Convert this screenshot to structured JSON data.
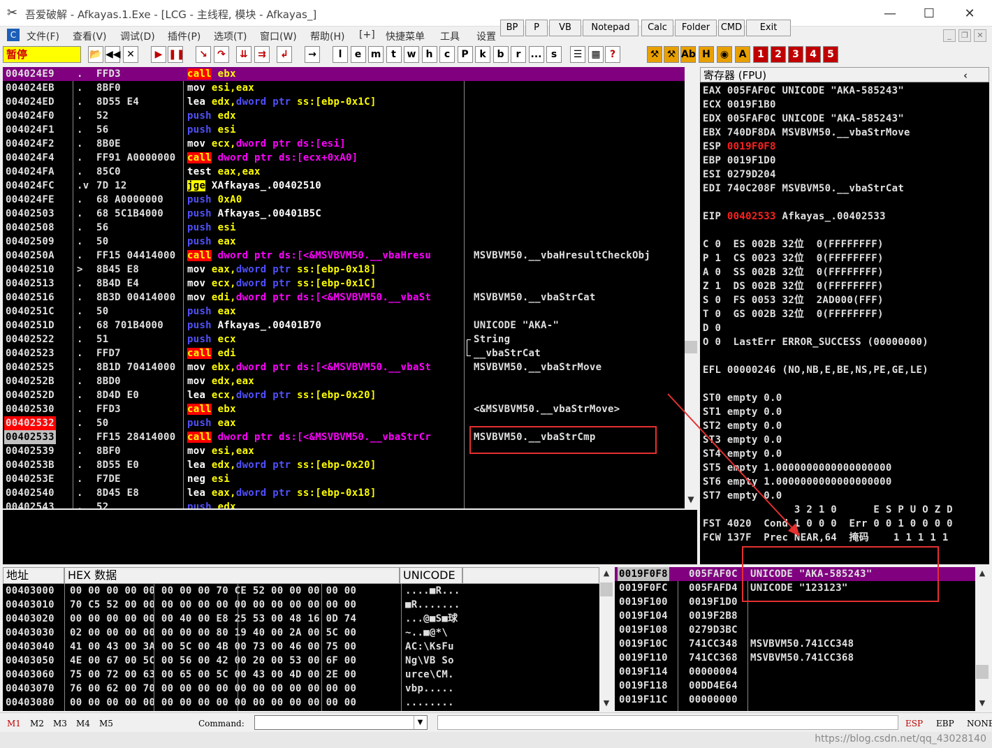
{
  "window": {
    "title": "吾爱破解 - Afkayas.1.Exe - [LCG - 主线程, 模块 - Afkayas_]",
    "minimize": "—",
    "maximize": "☐",
    "close": "✕"
  },
  "menu": [
    "文件(F)",
    "查看(V)",
    "调试(D)",
    "插件(P)",
    "选项(T)",
    "窗口(W)",
    "帮助(H)",
    "[+]",
    "快捷菜单",
    "工具",
    "设置"
  ],
  "quick_buttons": [
    "BP",
    "P",
    "VB",
    "Notepad",
    "Calc",
    "Folder",
    "CMD",
    "Exit"
  ],
  "toolbar": {
    "status": "暂停",
    "letters": [
      "l",
      "e",
      "m",
      "t",
      "w",
      "h",
      "c",
      "P",
      "k",
      "b",
      "r",
      "...",
      "s"
    ],
    "numbers": [
      "1",
      "2",
      "3",
      "4",
      "5"
    ]
  },
  "disasm": [
    {
      "addr": "004024E9",
      "m": ".",
      "hex": "FFD3",
      "ins": [
        [
          "call",
          "call"
        ],
        [
          " ",
          ""
        ],
        [
          "ebx",
          "dis-y"
        ]
      ],
      "cmt": "",
      "row": "purple"
    },
    {
      "addr": "004024EB",
      "m": ".",
      "hex": "8BF0",
      "ins": [
        [
          "mov ",
          "dis-w"
        ],
        [
          "esi,eax",
          "dis-y"
        ]
      ],
      "cmt": ""
    },
    {
      "addr": "004024ED",
      "m": ".",
      "hex": "8D55 E4",
      "ins": [
        [
          "lea ",
          "dis-w"
        ],
        [
          "edx,",
          "dis-y"
        ],
        [
          "dword ptr ",
          "dis-b"
        ],
        [
          "ss:[ebp-0x1C]",
          "dis-y"
        ]
      ],
      "cmt": ""
    },
    {
      "addr": "004024F0",
      "m": ".",
      "hex": "52",
      "ins": [
        [
          "push ",
          "dis-b"
        ],
        [
          "edx",
          "dis-y"
        ]
      ],
      "cmt": ""
    },
    {
      "addr": "004024F1",
      "m": ".",
      "hex": "56",
      "ins": [
        [
          "push ",
          "dis-b"
        ],
        [
          "esi",
          "dis-y"
        ]
      ],
      "cmt": ""
    },
    {
      "addr": "004024F2",
      "m": ".",
      "hex": "8B0E",
      "ins": [
        [
          "mov ",
          "dis-w"
        ],
        [
          "ecx,",
          "dis-y"
        ],
        [
          "dword ptr ",
          "dis-m"
        ],
        [
          "ds:[esi]",
          "dis-m"
        ]
      ],
      "cmt": ""
    },
    {
      "addr": "004024F4",
      "m": ".",
      "hex": "FF91 A0000000",
      "ins": [
        [
          "call",
          "call"
        ],
        [
          " dword ptr ds:[ecx+0xA0]",
          "dis-m"
        ]
      ],
      "cmt": ""
    },
    {
      "addr": "004024FA",
      "m": ".",
      "hex": "85C0",
      "ins": [
        [
          "test ",
          "dis-w"
        ],
        [
          "eax,eax",
          "dis-y"
        ]
      ],
      "cmt": ""
    },
    {
      "addr": "004024FC",
      "m": ".v",
      "hex": "7D 12",
      "ins": [
        [
          "jge",
          "jge"
        ],
        [
          " XAfkayas_.00402510",
          "dis-w"
        ]
      ],
      "cmt": ""
    },
    {
      "addr": "004024FE",
      "m": ".",
      "hex": "68 A0000000",
      "ins": [
        [
          "push ",
          "dis-b"
        ],
        [
          "0xA0",
          "dis-y"
        ]
      ],
      "cmt": ""
    },
    {
      "addr": "00402503",
      "m": ".",
      "hex": "68 5C1B4000",
      "ins": [
        [
          "push ",
          "dis-b"
        ],
        [
          "Afkayas_.00401B5C",
          "dis-w"
        ]
      ],
      "cmt": ""
    },
    {
      "addr": "00402508",
      "m": ".",
      "hex": "56",
      "ins": [
        [
          "push ",
          "dis-b"
        ],
        [
          "esi",
          "dis-y"
        ]
      ],
      "cmt": ""
    },
    {
      "addr": "00402509",
      "m": ".",
      "hex": "50",
      "ins": [
        [
          "push ",
          "dis-b"
        ],
        [
          "eax",
          "dis-y"
        ]
      ],
      "cmt": ""
    },
    {
      "addr": "0040250A",
      "m": ".",
      "hex": "FF15 04414000",
      "ins": [
        [
          "call",
          "call"
        ],
        [
          " dword ptr ds:[<&MSVBVM50.__vbaHresu",
          "dis-m"
        ]
      ],
      "cmt": "MSVBVM50.__vbaHresultCheckObj"
    },
    {
      "addr": "00402510",
      "m": ">",
      "hex": "8B45 E8",
      "ins": [
        [
          "mov ",
          "dis-w"
        ],
        [
          "eax,",
          "dis-y"
        ],
        [
          "dword ptr ",
          "dis-b"
        ],
        [
          "ss:[ebp-0x18]",
          "dis-y"
        ]
      ],
      "cmt": ""
    },
    {
      "addr": "00402513",
      "m": ".",
      "hex": "8B4D E4",
      "ins": [
        [
          "mov ",
          "dis-w"
        ],
        [
          "ecx,",
          "dis-y"
        ],
        [
          "dword ptr ",
          "dis-b"
        ],
        [
          "ss:[ebp-0x1C]",
          "dis-y"
        ]
      ],
      "cmt": ""
    },
    {
      "addr": "00402516",
      "m": ".",
      "hex": "8B3D 00414000",
      "ins": [
        [
          "mov ",
          "dis-w"
        ],
        [
          "edi,",
          "dis-y"
        ],
        [
          "dword ptr ds:[<&MSVBVM50.__vbaSt",
          "dis-m"
        ]
      ],
      "cmt": "MSVBVM50.__vbaStrCat"
    },
    {
      "addr": "0040251C",
      "m": ".",
      "hex": "50",
      "ins": [
        [
          "push ",
          "dis-b"
        ],
        [
          "eax",
          "dis-y"
        ]
      ],
      "cmt": ""
    },
    {
      "addr": "0040251D",
      "m": ".",
      "hex": "68 701B4000",
      "ins": [
        [
          "push ",
          "dis-b"
        ],
        [
          "Afkayas_.00401B70",
          "dis-w"
        ]
      ],
      "cmt": "UNICODE \"AKA-\""
    },
    {
      "addr": "00402522",
      "m": ".",
      "hex": "51",
      "ins": [
        [
          "push ",
          "dis-b"
        ],
        [
          "ecx",
          "dis-y"
        ]
      ],
      "cmt": "String"
    },
    {
      "addr": "00402523",
      "m": ".",
      "hex": "FFD7",
      "ins": [
        [
          "call",
          "call"
        ],
        [
          " ",
          "dis-w"
        ],
        [
          "edi",
          "dis-y"
        ]
      ],
      "cmt": "__vbaStrCat",
      "cmtClass": "red-t"
    },
    {
      "addr": "00402525",
      "m": ".",
      "hex": "8B1D 70414000",
      "ins": [
        [
          "mov ",
          "dis-w"
        ],
        [
          "ebx,",
          "dis-y"
        ],
        [
          "dword ptr ds:[<&MSVBVM50.__vbaSt",
          "dis-m"
        ]
      ],
      "cmt": "MSVBVM50.__vbaStrMove"
    },
    {
      "addr": "0040252B",
      "m": ".",
      "hex": "8BD0",
      "ins": [
        [
          "mov ",
          "dis-w"
        ],
        [
          "edx,eax",
          "dis-y"
        ]
      ],
      "cmt": ""
    },
    {
      "addr": "0040252D",
      "m": ".",
      "hex": "8D4D E0",
      "ins": [
        [
          "lea ",
          "dis-w"
        ],
        [
          "ecx,",
          "dis-y"
        ],
        [
          "dword ptr ",
          "dis-b"
        ],
        [
          "ss:[ebp-0x20]",
          "dis-y"
        ]
      ],
      "cmt": ""
    },
    {
      "addr": "00402530",
      "m": ".",
      "hex": "FFD3",
      "ins": [
        [
          "call",
          "call"
        ],
        [
          " ",
          "dis-w"
        ],
        [
          "ebx",
          "dis-y"
        ]
      ],
      "cmt": "<&MSVBVM50.__vbaStrMove>"
    },
    {
      "addr": "00402532",
      "m": ".",
      "hex": "50",
      "ins": [
        [
          "push ",
          "dis-b"
        ],
        [
          "eax",
          "dis-y"
        ]
      ],
      "cmt": "",
      "addrClass": "redbg"
    },
    {
      "addr": "00402533",
      "m": ".",
      "hex": "FF15 28414000",
      "ins": [
        [
          "call",
          "call"
        ],
        [
          " dword ptr ds:[<&MSVBVM50.__vbaStrCr",
          "dis-m"
        ]
      ],
      "cmt": "MSVBVM50.__vbaStrCmp",
      "addrClass": "graybg"
    },
    {
      "addr": "00402539",
      "m": ".",
      "hex": "8BF0",
      "ins": [
        [
          "mov ",
          "dis-w"
        ],
        [
          "esi,eax",
          "dis-y"
        ]
      ],
      "cmt": ""
    },
    {
      "addr": "0040253B",
      "m": ".",
      "hex": "8D55 E0",
      "ins": [
        [
          "lea ",
          "dis-w"
        ],
        [
          "edx,",
          "dis-y"
        ],
        [
          "dword ptr ",
          "dis-b"
        ],
        [
          "ss:[ebp-0x20]",
          "dis-y"
        ]
      ],
      "cmt": ""
    },
    {
      "addr": "0040253E",
      "m": ".",
      "hex": "F7DE",
      "ins": [
        [
          "neg ",
          "dis-w"
        ],
        [
          "esi",
          "dis-y"
        ]
      ],
      "cmt": ""
    },
    {
      "addr": "00402540",
      "m": ".",
      "hex": "8D45 E8",
      "ins": [
        [
          "lea ",
          "dis-w"
        ],
        [
          "eax,",
          "dis-y"
        ],
        [
          "dword ptr ",
          "dis-b"
        ],
        [
          "ss:[ebp-0x18]",
          "dis-y"
        ]
      ],
      "cmt": ""
    },
    {
      "addr": "00402543",
      "m": ".",
      "hex": "52",
      "ins": [
        [
          "push ",
          "dis-b"
        ],
        [
          "edx",
          "dis-y"
        ]
      ],
      "cmt": ""
    }
  ],
  "registers": {
    "header": "寄存器 (FPU)",
    "lines": [
      [
        "EAX 005FAF0C UNICODE \"AKA-585243\"",
        ""
      ],
      [
        "ECX 0019F1B0",
        ""
      ],
      [
        "EDX 005FAF0C UNICODE \"AKA-585243\"",
        ""
      ],
      [
        "EBX 740DF8DA MSVBVM50.__vbaStrMove",
        ""
      ],
      [
        "ESP |0019F0F8",
        ""
      ],
      [
        "EBP 0019F1D0",
        ""
      ],
      [
        "ESI 0279D204",
        ""
      ],
      [
        "EDI 740C208F MSVBVM50.__vbaStrCat",
        ""
      ],
      [
        "",
        ""
      ],
      [
        "EIP |00402533| Afkayas_.00402533",
        ""
      ],
      [
        "",
        ""
      ],
      [
        "C 0  ES 002B 32位  0(FFFFFFFF)",
        ""
      ],
      [
        "P 1  CS 0023 32位  0(FFFFFFFF)",
        ""
      ],
      [
        "A 0  SS 002B 32位  0(FFFFFFFF)",
        ""
      ],
      [
        "Z 1  DS 002B 32位  0(FFFFFFFF)",
        ""
      ],
      [
        "S 0  FS 0053 32位  2AD000(FFF)",
        ""
      ],
      [
        "T 0  GS 002B 32位  0(FFFFFFFF)",
        ""
      ],
      [
        "D 0",
        ""
      ],
      [
        "O 0  LastErr ERROR_SUCCESS (00000000)",
        ""
      ],
      [
        "",
        ""
      ],
      [
        "EFL 00000246 (NO,NB,E,BE,NS,PE,GE,LE)",
        ""
      ],
      [
        "",
        ""
      ],
      [
        "ST0 empty 0.0",
        ""
      ],
      [
        "ST1 empty 0.0",
        ""
      ],
      [
        "ST2 empty 0.0",
        ""
      ],
      [
        "ST3 empty 0.0",
        ""
      ],
      [
        "ST4 empty 0.0",
        ""
      ],
      [
        "ST5 empty 1.0000000000000000000",
        ""
      ],
      [
        "ST6 empty 1.0000000000000000000",
        ""
      ],
      [
        "ST7 empty 0.0",
        ""
      ],
      [
        "               3 2 1 0      E S P U O Z D",
        ""
      ],
      [
        "FST 4020  Cond 1 0 0 0  Err 0 0 1 0 0 0 0",
        ""
      ],
      [
        "FCW 137F  Prec NEAR,64  掩码    1 1 1 1 1",
        ""
      ]
    ]
  },
  "dump": {
    "headers": [
      "地址",
      "HEX 数据",
      "UNICODE"
    ],
    "rows": [
      {
        "a": "00403000",
        "h": "00 00 00 00 00 00 00 00 70 CE 52 00 00 00 00 00",
        "u": "....■R..."
      },
      {
        "a": "00403010",
        "h": "70 C5 52 00 00 00 00 00 00 00 00 00 00 00 00 00",
        "u": "■R......."
      },
      {
        "a": "00403020",
        "h": "00 00 00 00 00 00 40 00 E8 25 53 00 48 16 0D 74",
        "u": "...@■S■球"
      },
      {
        "a": "00403030",
        "h": "02 00 00 00 00 00 00 00 80 19 40 00 2A 00 5C 00",
        "u": "~..■@*\\"
      },
      {
        "a": "00403040",
        "h": "41 00 43 00 3A 00 5C 00 4B 00 73 00 46 00 75 00",
        "u": "AC:\\KsFu"
      },
      {
        "a": "00403050",
        "h": "4E 00 67 00 5C 00 56 00 42 00 20 00 53 00 6F 00",
        "u": "Ng\\VB So"
      },
      {
        "a": "00403060",
        "h": "75 00 72 00 63 00 65 00 5C 00 43 00 4D 00 2E 00",
        "u": "urce\\CM."
      },
      {
        "a": "00403070",
        "h": "76 00 62 00 70 00 00 00 00 00 00 00 00 00 00 00",
        "u": "vbp....."
      },
      {
        "a": "00403080",
        "h": "00 00 00 00 00 00 00 00 00 00 00 00 00 00 00 00",
        "u": "........"
      }
    ]
  },
  "stack": [
    {
      "a": "0019F0F8",
      "v": "005FAF0C",
      "c": "UNICODE \"AKA-585243\""
    },
    {
      "a": "0019F0FC",
      "v": "005FAFD4",
      "c": "UNICODE \"123123\""
    },
    {
      "a": "0019F100",
      "v": "0019F1D0",
      "c": ""
    },
    {
      "a": "0019F104",
      "v": "0019F2B8",
      "c": ""
    },
    {
      "a": "0019F108",
      "v": "0279D3BC",
      "c": ""
    },
    {
      "a": "0019F10C",
      "v": "741CC348",
      "c": "MSVBVM50.741CC348"
    },
    {
      "a": "0019F110",
      "v": "741CC368",
      "c": "MSVBVM50.741CC368"
    },
    {
      "a": "0019F114",
      "v": "00000004",
      "c": ""
    },
    {
      "a": "0019F118",
      "v": "00DD4E64",
      "c": ""
    },
    {
      "a": "0019F11C",
      "v": "00000000",
      "c": ""
    }
  ],
  "statusbar": {
    "m": [
      "M1",
      "M2",
      "M3",
      "M4",
      "M5"
    ],
    "command_label": "Command:",
    "command_value": "",
    "regs": [
      "ESP",
      "EBP",
      "NONE"
    ],
    "watermark": "https://blog.csdn.net/qq_43028140"
  }
}
